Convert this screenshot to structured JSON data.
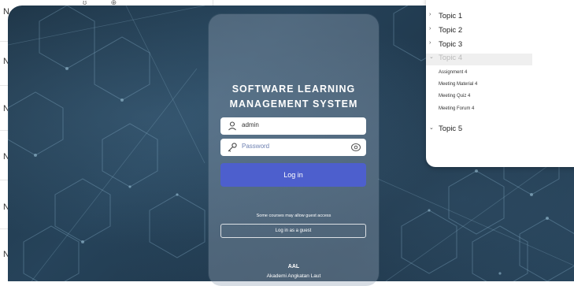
{
  "background_window": {
    "row_letters": [
      "N",
      "N",
      "N",
      "N",
      "N",
      "N"
    ],
    "icons": [
      "u-icon",
      "settings-icon"
    ]
  },
  "login": {
    "title_line1": "SOFTWARE LEARNING",
    "title_line2": "MANAGEMENT SYSTEM",
    "username_value": "admin",
    "password_placeholder": "Password",
    "login_button": "Log in",
    "guest_note": "Some courses may allow guest access",
    "guest_button": "Log in as a guest",
    "org_code": "AAL",
    "org_name": "Akademi Angkatan Laut",
    "accent_color": "#4d5fcd"
  },
  "topics": {
    "items": [
      {
        "label": "Topic 1",
        "expanded": false
      },
      {
        "label": "Topic 2",
        "expanded": false
      },
      {
        "label": "Topic 3",
        "expanded": false
      },
      {
        "label": "Topic 4",
        "expanded": true
      },
      {
        "label": "Topic 5",
        "expanded": true
      }
    ],
    "topic4_subitems": [
      "Assignment 4",
      "Meeting Material 4",
      "Meeting Quiz 4",
      "Meeting Forum 4"
    ]
  }
}
